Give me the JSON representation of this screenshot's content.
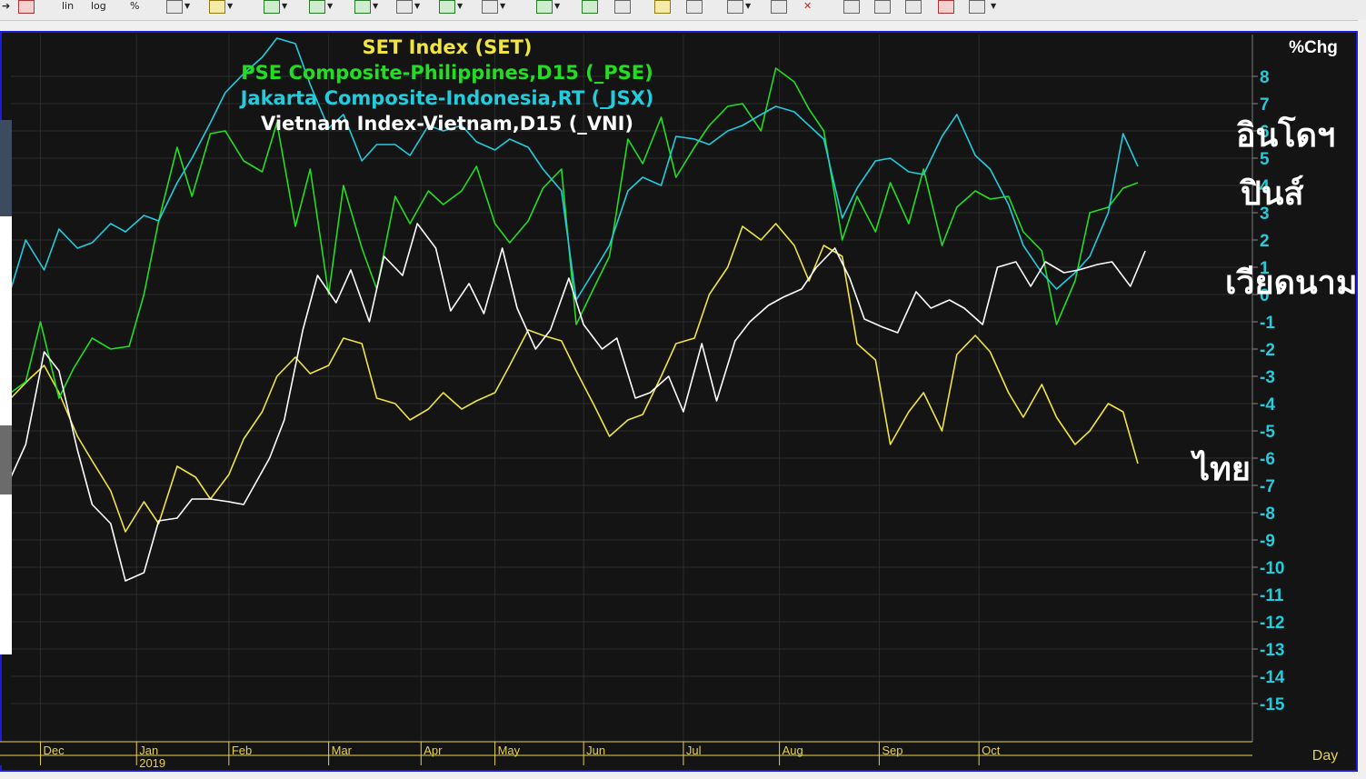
{
  "toolbar": {
    "btn_lin": "lin",
    "btn_log": "log",
    "btn_pct": "%",
    "icons": [
      "cart-icon",
      "add-chart-icon",
      "line-style-icon",
      "bar-chart-icon",
      "bar-chart-icon",
      "bar-chart-icon",
      "window-icon",
      "window-icon",
      "compare-icon",
      "bar-chart-icon",
      "close-chart-icon",
      "disabled-icon",
      "grid-icon",
      "table-icon",
      "notes-icon",
      "draw-icon",
      "delete-icon",
      "zoom-in-icon",
      "zoom-out-icon",
      "fit-icon",
      "refresh-icon",
      "lock-icon"
    ]
  },
  "chart_data": {
    "type": "line",
    "legend": [
      {
        "name": "SET  Index  (SET)",
        "color": "#f0e442"
      },
      {
        "name": "PSE  Composite-Philippines,D15  (_PSE)",
        "color": "#22dd22"
      },
      {
        "name": "Jakarta  Composite-Indonesia,RT  (_JSX)",
        "color": "#22ccdd"
      },
      {
        "name": "Vietnam  Index-Vietnam,D15  (_VNI)",
        "color": "#ffffff"
      }
    ],
    "y_axis": {
      "label": "%Chg",
      "ticks": [
        8,
        7,
        6,
        5,
        4,
        3,
        2,
        1,
        0,
        -1,
        -2,
        -3,
        -4,
        -5,
        -6,
        -7,
        -8,
        -9,
        -10,
        -11,
        -12,
        -13,
        -14,
        -15
      ],
      "range": [
        -15,
        8
      ]
    },
    "x_axis": {
      "label": "Day",
      "months": [
        "Dec",
        "Jan",
        "Feb",
        "Mar",
        "Apr",
        "May",
        "Jun",
        "Jul",
        "Aug",
        "Sep",
        "Oct"
      ],
      "year": "2019",
      "range": [
        0,
        336
      ]
    },
    "annotations": [
      {
        "text": "อินโดฯ",
        "series": "_JSX"
      },
      {
        "text": "ปินส์",
        "series": "_PSE"
      },
      {
        "text": "เวียดนาม",
        "series": "_VNI"
      },
      {
        "text": "ไทย",
        "series": "SET"
      }
    ],
    "month_days": [
      8,
      34,
      59,
      86,
      111,
      131,
      155,
      182,
      208,
      235,
      262
    ],
    "series": [
      {
        "name": "SET",
        "color": "#f0e442",
        "points": [
          [
            0,
            -3.8
          ],
          [
            5,
            -3.1
          ],
          [
            9,
            -2.6
          ],
          [
            13,
            -3.6
          ],
          [
            18,
            -5.2
          ],
          [
            22,
            -6.1
          ],
          [
            27,
            -7.2
          ],
          [
            31,
            -8.7
          ],
          [
            36,
            -7.6
          ],
          [
            40,
            -8.4
          ],
          [
            45,
            -6.3
          ],
          [
            50,
            -6.7
          ],
          [
            54,
            -7.5
          ],
          [
            59,
            -6.6
          ],
          [
            63,
            -5.3
          ],
          [
            68,
            -4.3
          ],
          [
            72,
            -3.0
          ],
          [
            77,
            -2.3
          ],
          [
            81,
            -2.9
          ],
          [
            86,
            -2.6
          ],
          [
            90,
            -1.6
          ],
          [
            95,
            -1.8
          ],
          [
            99,
            -3.8
          ],
          [
            104,
            -4.0
          ],
          [
            108,
            -4.6
          ],
          [
            113,
            -4.2
          ],
          [
            117,
            -3.6
          ],
          [
            122,
            -4.2
          ],
          [
            126,
            -3.9
          ],
          [
            131,
            -3.6
          ],
          [
            135,
            -2.6
          ],
          [
            140,
            -1.3
          ],
          [
            144,
            -1.5
          ],
          [
            149,
            -1.7
          ],
          [
            153,
            -2.8
          ],
          [
            158,
            -4.1
          ],
          [
            162,
            -5.2
          ],
          [
            167,
            -4.6
          ],
          [
            171,
            -4.4
          ],
          [
            176,
            -3.0
          ],
          [
            180,
            -1.8
          ],
          [
            185,
            -1.6
          ],
          [
            189,
            0.0
          ],
          [
            194,
            1.0
          ],
          [
            198,
            2.5
          ],
          [
            203,
            2.0
          ],
          [
            207,
            2.6
          ],
          [
            212,
            1.8
          ],
          [
            216,
            0.5
          ],
          [
            220,
            1.8
          ],
          [
            225,
            1.4
          ],
          [
            229,
            -1.8
          ],
          [
            234,
            -2.4
          ],
          [
            238,
            -5.5
          ],
          [
            243,
            -4.3
          ],
          [
            247,
            -3.6
          ],
          [
            252,
            -5.0
          ],
          [
            256,
            -2.2
          ],
          [
            261,
            -1.5
          ],
          [
            265,
            -2.1
          ],
          [
            270,
            -3.6
          ],
          [
            274,
            -4.5
          ],
          [
            279,
            -3.3
          ],
          [
            283,
            -4.5
          ],
          [
            288,
            -5.5
          ],
          [
            292,
            -5.0
          ],
          [
            297,
            -4.0
          ],
          [
            301,
            -4.3
          ],
          [
            305,
            -6.2
          ]
        ]
      },
      {
        "name": "_PSE",
        "color": "#22dd22",
        "points": [
          [
            0,
            -3.6
          ],
          [
            4,
            -3.2
          ],
          [
            8,
            -1.0
          ],
          [
            13,
            -3.8
          ],
          [
            17,
            -2.7
          ],
          [
            22,
            -1.6
          ],
          [
            27,
            -2.0
          ],
          [
            32,
            -1.9
          ],
          [
            36,
            0.0
          ],
          [
            40,
            2.7
          ],
          [
            45,
            5.4
          ],
          [
            49,
            3.6
          ],
          [
            54,
            5.9
          ],
          [
            58,
            6.0
          ],
          [
            63,
            4.9
          ],
          [
            68,
            4.5
          ],
          [
            72,
            6.3
          ],
          [
            77,
            2.5
          ],
          [
            81,
            4.6
          ],
          [
            86,
            0.0
          ],
          [
            90,
            4.0
          ],
          [
            95,
            1.7
          ],
          [
            99,
            0.2
          ],
          [
            104,
            3.6
          ],
          [
            108,
            2.6
          ],
          [
            113,
            3.8
          ],
          [
            117,
            3.3
          ],
          [
            122,
            3.8
          ],
          [
            126,
            4.7
          ],
          [
            131,
            2.6
          ],
          [
            135,
            1.9
          ],
          [
            140,
            2.7
          ],
          [
            144,
            3.9
          ],
          [
            149,
            4.6
          ],
          [
            153,
            -1.1
          ],
          [
            158,
            0.3
          ],
          [
            162,
            1.4
          ],
          [
            167,
            5.7
          ],
          [
            171,
            4.8
          ],
          [
            176,
            6.5
          ],
          [
            180,
            4.3
          ],
          [
            185,
            5.4
          ],
          [
            189,
            6.2
          ],
          [
            194,
            6.9
          ],
          [
            198,
            7.0
          ],
          [
            203,
            6.0
          ],
          [
            207,
            8.3
          ],
          [
            212,
            7.8
          ],
          [
            216,
            6.8
          ],
          [
            220,
            6.0
          ],
          [
            225,
            2.0
          ],
          [
            229,
            3.6
          ],
          [
            234,
            2.3
          ],
          [
            238,
            4.1
          ],
          [
            243,
            2.6
          ],
          [
            247,
            4.6
          ],
          [
            252,
            1.8
          ],
          [
            256,
            3.2
          ],
          [
            261,
            3.8
          ],
          [
            265,
            3.5
          ],
          [
            270,
            3.6
          ],
          [
            274,
            2.3
          ],
          [
            279,
            1.6
          ],
          [
            283,
            -1.1
          ],
          [
            288,
            0.5
          ],
          [
            292,
            3.0
          ],
          [
            297,
            3.2
          ],
          [
            301,
            3.9
          ],
          [
            305,
            4.1
          ]
        ]
      },
      {
        "name": "_JSX",
        "color": "#22ccdd",
        "points": [
          [
            0,
            0.2
          ],
          [
            4,
            2.0
          ],
          [
            9,
            0.9
          ],
          [
            13,
            2.4
          ],
          [
            18,
            1.7
          ],
          [
            22,
            1.9
          ],
          [
            27,
            2.6
          ],
          [
            31,
            2.3
          ],
          [
            36,
            2.9
          ],
          [
            40,
            2.7
          ],
          [
            45,
            4.1
          ],
          [
            49,
            5.0
          ],
          [
            54,
            6.3
          ],
          [
            58,
            7.4
          ],
          [
            63,
            8.1
          ],
          [
            68,
            8.7
          ],
          [
            72,
            9.4
          ],
          [
            77,
            9.2
          ],
          [
            81,
            7.7
          ],
          [
            86,
            6.1
          ],
          [
            90,
            6.6
          ],
          [
            95,
            4.9
          ],
          [
            99,
            5.5
          ],
          [
            104,
            5.5
          ],
          [
            108,
            5.1
          ],
          [
            113,
            6.2
          ],
          [
            117,
            6.0
          ],
          [
            122,
            6.2
          ],
          [
            126,
            5.6
          ],
          [
            131,
            5.3
          ],
          [
            135,
            5.7
          ],
          [
            140,
            5.4
          ],
          [
            144,
            4.6
          ],
          [
            149,
            3.8
          ],
          [
            153,
            -0.2
          ],
          [
            158,
            0.9
          ],
          [
            162,
            1.8
          ],
          [
            167,
            3.8
          ],
          [
            171,
            4.3
          ],
          [
            176,
            4.0
          ],
          [
            180,
            5.8
          ],
          [
            185,
            5.7
          ],
          [
            189,
            5.5
          ],
          [
            194,
            6.0
          ],
          [
            198,
            6.2
          ],
          [
            203,
            6.6
          ],
          [
            207,
            6.9
          ],
          [
            212,
            6.7
          ],
          [
            216,
            6.2
          ],
          [
            220,
            5.7
          ],
          [
            225,
            2.8
          ],
          [
            229,
            3.9
          ],
          [
            234,
            4.9
          ],
          [
            238,
            5.0
          ],
          [
            243,
            4.5
          ],
          [
            247,
            4.4
          ],
          [
            252,
            5.8
          ],
          [
            256,
            6.6
          ],
          [
            261,
            5.1
          ],
          [
            265,
            4.6
          ],
          [
            270,
            3.3
          ],
          [
            274,
            1.8
          ],
          [
            279,
            0.8
          ],
          [
            283,
            0.2
          ],
          [
            288,
            0.8
          ],
          [
            292,
            1.4
          ],
          [
            297,
            3.0
          ],
          [
            301,
            5.9
          ],
          [
            305,
            4.7
          ]
        ]
      },
      {
        "name": "_VNI",
        "color": "#ffffff",
        "points": [
          [
            0,
            -6.7
          ],
          [
            4,
            -5.5
          ],
          [
            9,
            -2.1
          ],
          [
            13,
            -2.8
          ],
          [
            18,
            -5.7
          ],
          [
            22,
            -7.7
          ],
          [
            27,
            -8.4
          ],
          [
            31,
            -10.5
          ],
          [
            36,
            -10.2
          ],
          [
            40,
            -8.3
          ],
          [
            45,
            -8.2
          ],
          [
            49,
            -7.5
          ],
          [
            54,
            -7.5
          ],
          [
            59,
            -7.6
          ],
          [
            63,
            -7.7
          ],
          [
            70,
            -6.0
          ],
          [
            74,
            -4.6
          ],
          [
            79,
            -1.3
          ],
          [
            83,
            0.7
          ],
          [
            88,
            -0.3
          ],
          [
            92,
            0.9
          ],
          [
            97,
            -1.0
          ],
          [
            101,
            1.4
          ],
          [
            106,
            0.7
          ],
          [
            110,
            2.6
          ],
          [
            115,
            1.7
          ],
          [
            119,
            -0.6
          ],
          [
            124,
            0.4
          ],
          [
            128,
            -0.7
          ],
          [
            133,
            1.7
          ],
          [
            137,
            -0.5
          ],
          [
            142,
            -2.0
          ],
          [
            146,
            -1.3
          ],
          [
            151,
            0.6
          ],
          [
            155,
            -1.1
          ],
          [
            160,
            -2.0
          ],
          [
            164,
            -1.6
          ],
          [
            169,
            -3.8
          ],
          [
            173,
            -3.6
          ],
          [
            178,
            -3.0
          ],
          [
            182,
            -4.3
          ],
          [
            187,
            -1.8
          ],
          [
            191,
            -3.9
          ],
          [
            196,
            -1.7
          ],
          [
            200,
            -1.0
          ],
          [
            205,
            -0.4
          ],
          [
            209,
            -0.1
          ],
          [
            214,
            0.2
          ],
          [
            218,
            1.0
          ],
          [
            223,
            1.7
          ],
          [
            227,
            0.6
          ],
          [
            231,
            -0.9
          ],
          [
            236,
            -1.2
          ],
          [
            240,
            -1.4
          ],
          [
            245,
            0.1
          ],
          [
            249,
            -0.5
          ],
          [
            254,
            -0.2
          ],
          [
            258,
            -0.5
          ],
          [
            263,
            -1.1
          ],
          [
            267,
            1.0
          ],
          [
            272,
            1.2
          ],
          [
            276,
            0.3
          ],
          [
            280,
            1.2
          ],
          [
            285,
            0.8
          ],
          [
            289,
            0.9
          ],
          [
            294,
            1.1
          ],
          [
            298,
            1.2
          ],
          [
            303,
            0.3
          ],
          [
            307,
            1.6
          ]
        ]
      }
    ]
  }
}
